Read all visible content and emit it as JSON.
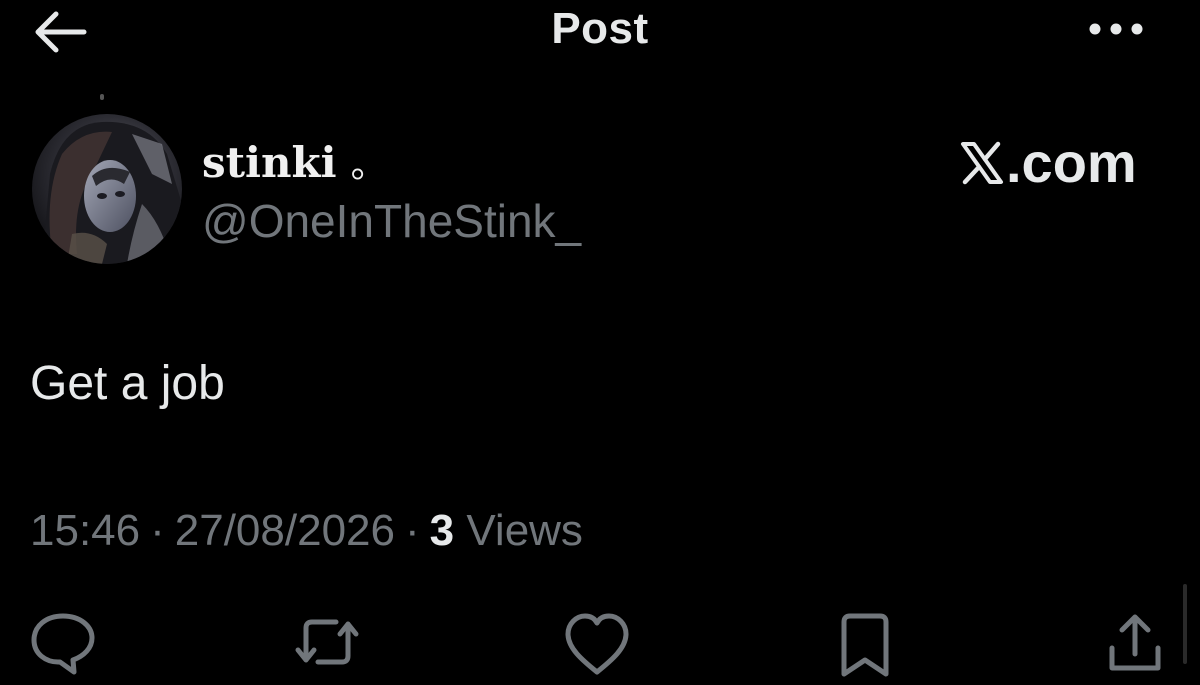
{
  "header": {
    "title": "Post",
    "back_icon": "arrow-left-icon",
    "more_icon": "more-horizontal-icon"
  },
  "author": {
    "display_name": "stinki",
    "name_suffix": "。",
    "handle": "@OneInTheStink_",
    "avatar_icon": "avatar"
  },
  "watermark": {
    "label": ".com",
    "logo_icon": "x-logo-icon"
  },
  "post": {
    "text": "Get a job",
    "time": "15:46",
    "date": "27/08/2026",
    "separator": "·",
    "views_count": "3",
    "views_label": "Views"
  },
  "actions": [
    {
      "name": "reply",
      "icon": "reply-icon"
    },
    {
      "name": "repost",
      "icon": "repost-icon"
    },
    {
      "name": "like",
      "icon": "heart-icon"
    },
    {
      "name": "bookmark",
      "icon": "bookmark-icon"
    },
    {
      "name": "share",
      "icon": "share-icon"
    }
  ],
  "colors": {
    "background": "#000000",
    "primary_text": "#e7e9ea",
    "secondary_text": "#71767b"
  }
}
